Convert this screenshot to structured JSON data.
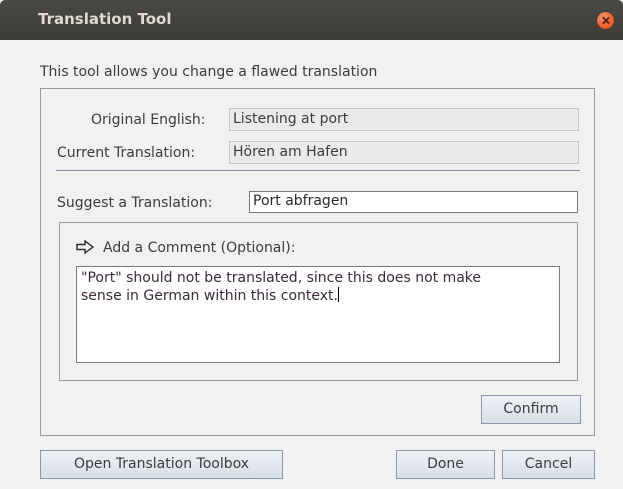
{
  "window": {
    "title": "Translation Tool"
  },
  "intro_text": "This tool allows you change a flawed translation",
  "original": {
    "label": "Original English:",
    "value": "Listening at port"
  },
  "current": {
    "label": "Current Translation:",
    "value": "Hören am Hafen"
  },
  "suggest": {
    "label": "Suggest a Translation:",
    "value": "Port abfragen"
  },
  "comment": {
    "label": "Add a Comment (Optional):",
    "value": "\"Port\" should not be translated, since this does not make\nsense in German within this context."
  },
  "buttons": {
    "confirm": "Confirm",
    "open_toolbox": "Open Translation Toolbox",
    "done": "Done",
    "cancel": "Cancel"
  },
  "colors": {
    "title_bar": "#3c3b37",
    "close_button": "#e95420",
    "dialog_bg": "#f2f1f0"
  },
  "icons": {
    "close": "close-icon",
    "comment_arrow": "arrow-right-outline-icon"
  }
}
